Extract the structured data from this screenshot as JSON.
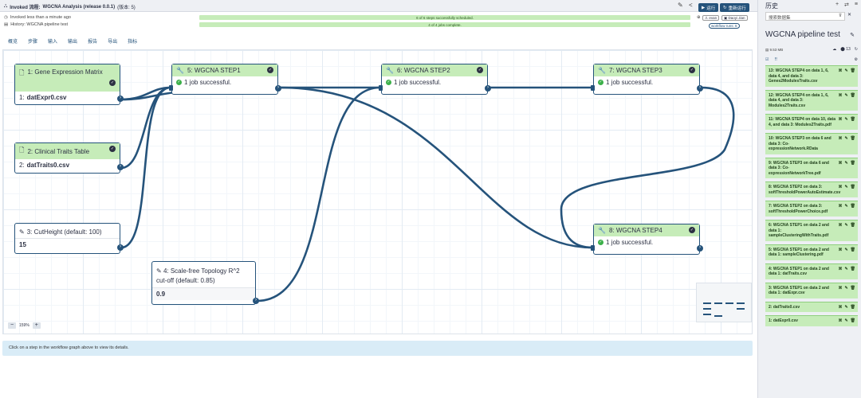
{
  "header": {
    "title_prefix": "Invoked 流程:",
    "title": "WGCNA Analysis (release 0.0.1)",
    "version": "(版本: 5)",
    "edit_icon": "edit-icon",
    "share_icon": "share-icon",
    "run_label": "运行",
    "rerun_label": "重新运行"
  },
  "invocation": {
    "time_text": "Invoked less than a minute ago",
    "history_text": "History: WGCNA pipeline test",
    "scheduled_text": "6 of 6 steps successfully scheduled.",
    "jobs_text": "4 of 4 jobs complete.",
    "user": "evan",
    "owner": "Daoyi Jian",
    "workflow_runs": "workflow runs: 6"
  },
  "tabs": [
    "概览",
    "步骤",
    "输入",
    "输出",
    "报告",
    "导出",
    "指标"
  ],
  "nodes": {
    "n1": {
      "title": "1: Gene Expression Matrix",
      "out_label": "1:",
      "out_value": "datExpr0.csv"
    },
    "n2": {
      "title": "2: Clinical Traits Table",
      "out_label": "2:",
      "out_value": "datTraits0.csv"
    },
    "n3": {
      "title": "3: CutHeight (default: 100)",
      "value": "15"
    },
    "n4": {
      "title_line1": "4: Scale-free Topology R^2",
      "title_line2": "cut-off (default: 0.85)",
      "value": "0.9"
    },
    "n5": {
      "title": "5: WGCNA STEP1",
      "status": "1 job successful."
    },
    "n6": {
      "title": "6: WGCNA STEP2",
      "status": "1 job successful."
    },
    "n7": {
      "title": "7: WGCNA STEP3",
      "status": "1 job successful."
    },
    "n8": {
      "title": "8: WGCNA STEP4",
      "status": "1 job successful."
    }
  },
  "zoom": {
    "minus": "−",
    "level": "159%",
    "plus": "+"
  },
  "details_text": "Click on a step in the workflow graph above to view its details.",
  "history": {
    "title": "历史",
    "search_placeholder": "搜索数据集",
    "name": "WGCNA pipeline test",
    "size": "9.53 MB",
    "count": "13",
    "items": [
      "13: WGCNA STEP4 on data 1, 6, data 4, and data 3: Genes2ModulesTraits.csv",
      "12: WGCNA STEP4 on data 1, 6, data 4, and data 3: Modules2Traits.csv",
      "11: WGCNA STEP4 on data 10, data 4, and data 3: Modules2Traits.pdf",
      "10: WGCNA STEP3 on data 6 and data 3: Co-expressionNetwork.RData",
      "9: WGCNA STEP3 on data 6 and data 3: Co-expressionNetworkTree.pdf",
      "8: WGCNA STEP2 on data 3: softThresholdPowerAutoEstimate.csv",
      "7: WGCNA STEP2 on data 3: softThresholdPowerChoice.pdf",
      "6: WGCNA STEP1 on data 2 and data 1: sampleClusteringWithTraits.pdf",
      "5: WGCNA STEP1 on data 2 and data 1: sampleClustering.pdf",
      "4: WGCNA STEP1 on data 2 and data 1: datTraits.csv",
      "3: WGCNA STEP1 on data 2 and data 1: datExpr.csv",
      "2: datTraits0.csv",
      "1: datExpr0.csv"
    ]
  },
  "colors": {
    "accent": "#25537b",
    "success_bg": "#c6ecb9",
    "ok": "#3cb04a"
  }
}
